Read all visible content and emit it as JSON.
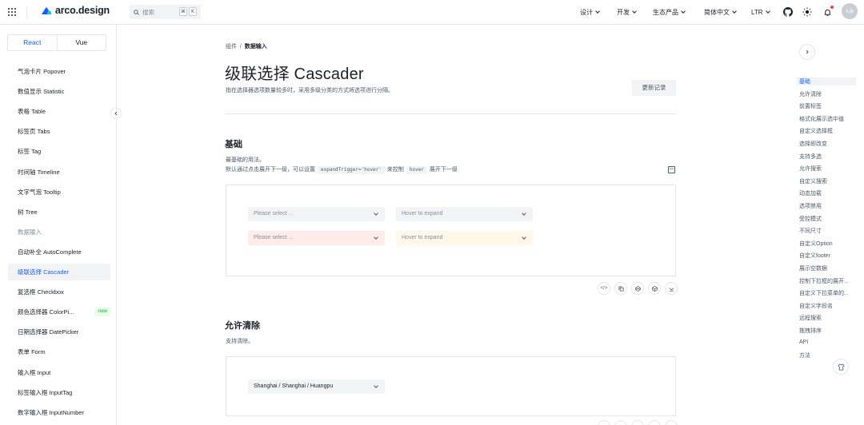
{
  "header": {
    "brand": "arco.design",
    "search_placeholder": "搜索",
    "kbd_cmd": "⌘",
    "kbd_k": "K",
    "nav": [
      "设计",
      "开发",
      "生态产品",
      "简体中文",
      "LTR"
    ],
    "avatar_text": "头像"
  },
  "sidebar": {
    "frameworks": [
      "React",
      "Vue"
    ],
    "items": [
      {
        "label": "气泡卡片 Popover",
        "type": "item"
      },
      {
        "label": "数值显示 Statistic",
        "type": "item"
      },
      {
        "label": "表格 Table",
        "type": "item"
      },
      {
        "label": "标签页 Tabs",
        "type": "item"
      },
      {
        "label": "标签 Tag",
        "type": "item"
      },
      {
        "label": "时间轴 Timeline",
        "type": "item"
      },
      {
        "label": "文字气泡 Tooltip",
        "type": "item"
      },
      {
        "label": "树 Tree",
        "type": "item"
      },
      {
        "label": "数据输入",
        "type": "group"
      },
      {
        "label": "自动补全 AutoComplete",
        "type": "item"
      },
      {
        "label": "级联选择 Cascader",
        "type": "selected"
      },
      {
        "label": "复选框 Checkbox",
        "type": "item"
      },
      {
        "label": "颜色选择器 ColorPi...",
        "type": "item",
        "badge": "new"
      },
      {
        "label": "日期选择器 DatePicker",
        "type": "item"
      },
      {
        "label": "表单 Form",
        "type": "item"
      },
      {
        "label": "输入框 Input",
        "type": "item"
      },
      {
        "label": "标签输入框 InputTag",
        "type": "item"
      },
      {
        "label": "数字输入框 InputNumber",
        "type": "item"
      }
    ]
  },
  "main": {
    "breadcrumb": [
      "组件",
      "数据输入"
    ],
    "title": "级联选择 Cascader",
    "description": "指在选择器选项数量较多时，采用多级分类的方式将选项进行分隔。",
    "changelog_button": "更新记录",
    "sections": {
      "basic": {
        "title": "基础",
        "line1": "最基础的用法。",
        "line2_prefix": "默认通过点击展开下一级，可以设置",
        "code1": "expandTrigger='hover'",
        "line2_mid": "来控制",
        "code2": "hover",
        "line2_suffix": "展开下一级",
        "select_placeholder": "Please select ...",
        "hover_placeholder": "Hover to expand"
      },
      "clear": {
        "title": "允许清除",
        "text": "支持清除。",
        "select_value": "Shanghai / Shanghai / Huangpu"
      }
    }
  },
  "anchors": [
    "基础",
    "允许清除",
    "前置标签",
    "格式化展示选中值",
    "自定义选择框",
    "选择即改变",
    "支持多选",
    "允许搜索",
    "自定义搜索",
    "动态加载",
    "选项禁用",
    "受控模式",
    "不同尺寸",
    "自定义Option",
    "自定义footer",
    "展示空数据",
    "控制下拉框的展开...",
    "自定义下拉菜单的...",
    "自定义字段名",
    "远程搜索",
    "拖拽排序",
    "API",
    "方法"
  ],
  "colors": {
    "primary": "#165dff",
    "error_bg": "#ffece8",
    "warning_bg": "#fff7e8",
    "new_badge": "#00b42a"
  }
}
